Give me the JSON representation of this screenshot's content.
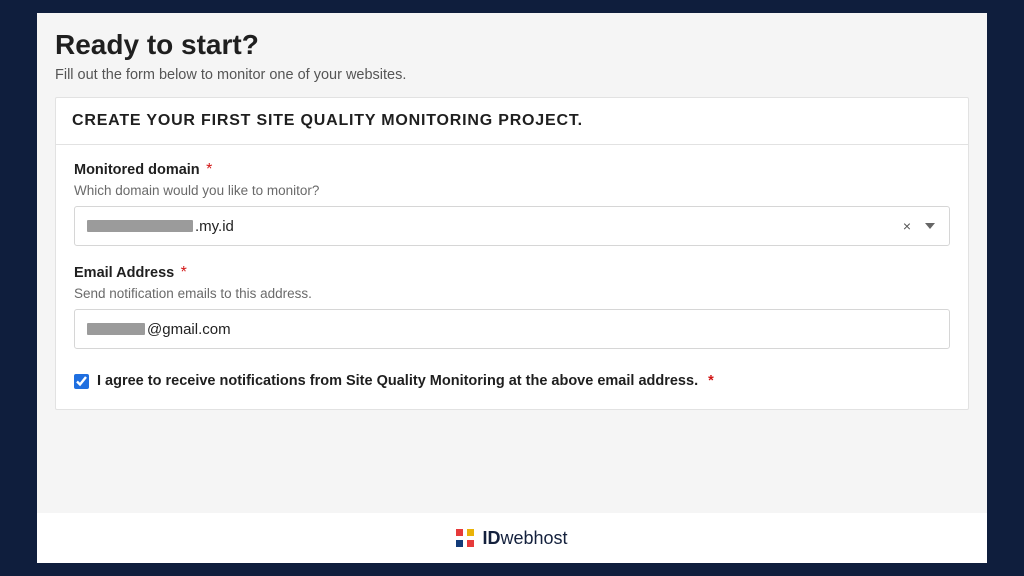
{
  "header": {
    "title": "Ready to start?",
    "subtitle": "Fill out the form below to monitor one of your websites."
  },
  "card": {
    "title": "CREATE YOUR FIRST SITE QUALITY MONITORING PROJECT."
  },
  "domain_field": {
    "label": "Monitored domain",
    "required_mark": "*",
    "help": "Which domain would you like to monitor?",
    "value_suffix": ".my.id",
    "clear_symbol": "×"
  },
  "email_field": {
    "label": "Email Address",
    "required_mark": "*",
    "help": "Send notification emails to this address.",
    "value_suffix": "@gmail.com"
  },
  "consent": {
    "checked": true,
    "text": "I agree to receive notifications from Site Quality Monitoring at the above email address.",
    "required_mark": "*"
  },
  "footer": {
    "brand_bold": "ID",
    "brand_rest": "webhost"
  }
}
